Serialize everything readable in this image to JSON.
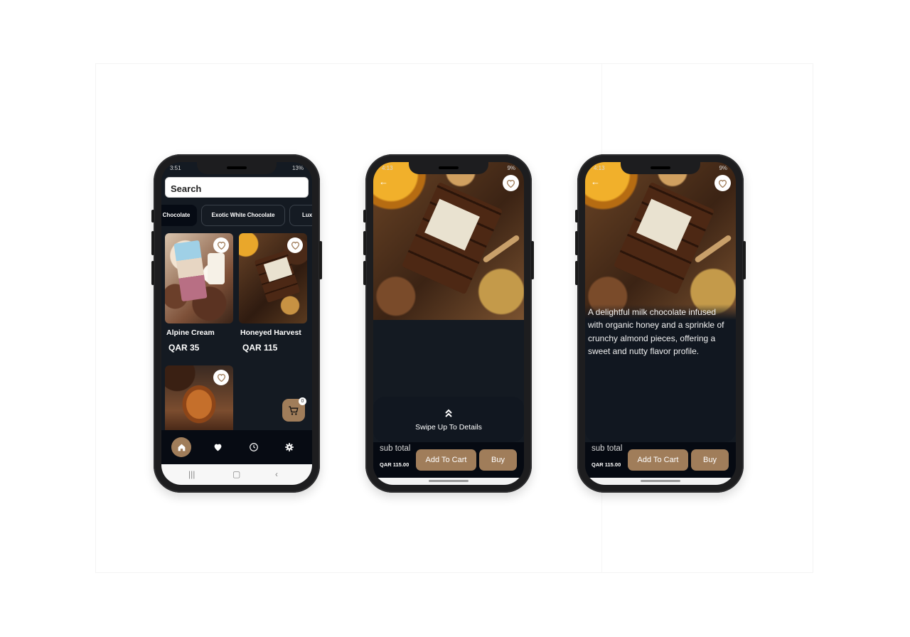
{
  "screen1": {
    "status": {
      "time": "3:51",
      "right": "13%"
    },
    "search": {
      "value": "Search"
    },
    "categories": [
      {
        "label": "Chocolate",
        "active": true
      },
      {
        "label": "Exotic White Chocolate",
        "active": false
      },
      {
        "label": "Lux",
        "active": false
      }
    ],
    "products": [
      {
        "title": "Alpine Cream",
        "price": "QAR 35"
      },
      {
        "title": "Honeyed Harvest",
        "price": "QAR 115"
      },
      {
        "title": "",
        "price": ""
      }
    ],
    "cart_count": "0",
    "nav_items": [
      "home-icon",
      "heart-icon",
      "history-icon",
      "gear-icon"
    ]
  },
  "screen2": {
    "status": {
      "time": "4:13",
      "right": "9%"
    },
    "swipe_label": "Swipe Up To Details",
    "subtotal_label": "sub total",
    "subtotal_value": "QAR 115.00",
    "add_to_cart": "Add To Cart",
    "buy": "Buy"
  },
  "screen3": {
    "status": {
      "time": "4:13",
      "right": "9%"
    },
    "description": "A delightful milk chocolate infused with organic honey and a sprinkle of crunchy almond pieces, offering a sweet and nutty flavor profile.",
    "subtotal_label": "sub total",
    "subtotal_value": "QAR 115.00",
    "add_to_cart": "Add To Cart",
    "buy": "Buy"
  },
  "colors": {
    "accent": "#a07d5a",
    "background": "#141a22",
    "nav": "#070b13"
  }
}
